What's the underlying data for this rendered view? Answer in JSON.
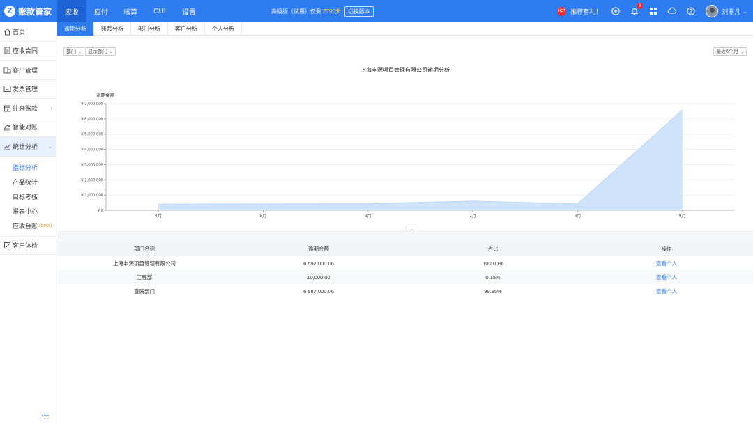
{
  "brand": {
    "logo_letter": "Z",
    "name": "账款管家"
  },
  "nav": [
    {
      "label": "应收",
      "active": true
    },
    {
      "label": "应付"
    },
    {
      "label": "核算"
    },
    {
      "label": "CUI"
    },
    {
      "label": "设置"
    }
  ],
  "version": {
    "text": "高级版（试用）仅剩",
    "days": "2790天",
    "switch_label": "切换版本"
  },
  "header_right": {
    "hot": "HOT",
    "promo": "推荐有礼！",
    "notification_count": "9",
    "user_name": "刘非凡"
  },
  "sidebar": {
    "items": [
      {
        "label": "首页",
        "icon": "home-icon"
      },
      {
        "label": "应收合同",
        "icon": "contract-icon"
      },
      {
        "label": "客户管理",
        "icon": "customer-icon"
      },
      {
        "label": "发票管理",
        "icon": "invoice-icon"
      },
      {
        "label": "往来账款",
        "icon": "ledger-icon",
        "arrow": "›"
      },
      {
        "label": "智能对账",
        "icon": "reconcile-icon"
      },
      {
        "label": "统计分析",
        "icon": "stats-icon",
        "arrow": "⌄",
        "active": true
      }
    ],
    "sub_items": [
      {
        "label": "指标分析",
        "active": true
      },
      {
        "label": "产品统计"
      },
      {
        "label": "目标考核"
      },
      {
        "label": "报表中心"
      },
      {
        "label": "应收台账",
        "beta": "(beta)"
      }
    ],
    "extra_item": {
      "label": "客户体检",
      "icon": "checkup-icon"
    }
  },
  "tabs": [
    {
      "label": "逾期分析",
      "active": true
    },
    {
      "label": "账龄分析"
    },
    {
      "label": "部门分析"
    },
    {
      "label": "客户分析"
    },
    {
      "label": "个人分析"
    }
  ],
  "filters": {
    "dimension": "部门",
    "department": "显示部门",
    "range": "最近6个月"
  },
  "chart_data": {
    "type": "area",
    "title": "上海丰源项目管理有限公司逾期分析",
    "ylabel": "逾期金额",
    "categories": [
      "4月",
      "5月",
      "6月",
      "7月",
      "8月",
      "9月"
    ],
    "series": [
      {
        "values": [
          400000,
          420000,
          430000,
          600000,
          420000,
          6597000
        ]
      }
    ],
    "ylim": [
      0,
      7000000
    ],
    "yticks": [
      0,
      1000000,
      2000000,
      3000000,
      4000000,
      5000000,
      6000000,
      7000000
    ],
    "ytick_labels": [
      "¥ 0",
      "¥ 1,000,000",
      "¥ 2,000,000",
      "¥ 3,000,000",
      "¥ 4,000,000",
      "¥ 5,000,000",
      "¥ 6,000,000",
      "¥ 7,000,000"
    ],
    "grid": true,
    "color": "#cfe3fa",
    "line_color": "#b9d6f6"
  },
  "table": {
    "headers": [
      "部门名称",
      "逾期金额",
      "占比",
      "操作"
    ],
    "rows": [
      {
        "name": "上海丰源项目管理有限公司",
        "amount": "6,597,000.06",
        "ratio": "100.00%",
        "action": "查看个人"
      },
      {
        "name": "工程部",
        "amount": "10,000.00",
        "ratio": "0.15%",
        "action": "查看个人"
      },
      {
        "name": "直属部门",
        "amount": "6,587,000.06",
        "ratio": "99.85%",
        "action": "查看个人"
      }
    ]
  }
}
